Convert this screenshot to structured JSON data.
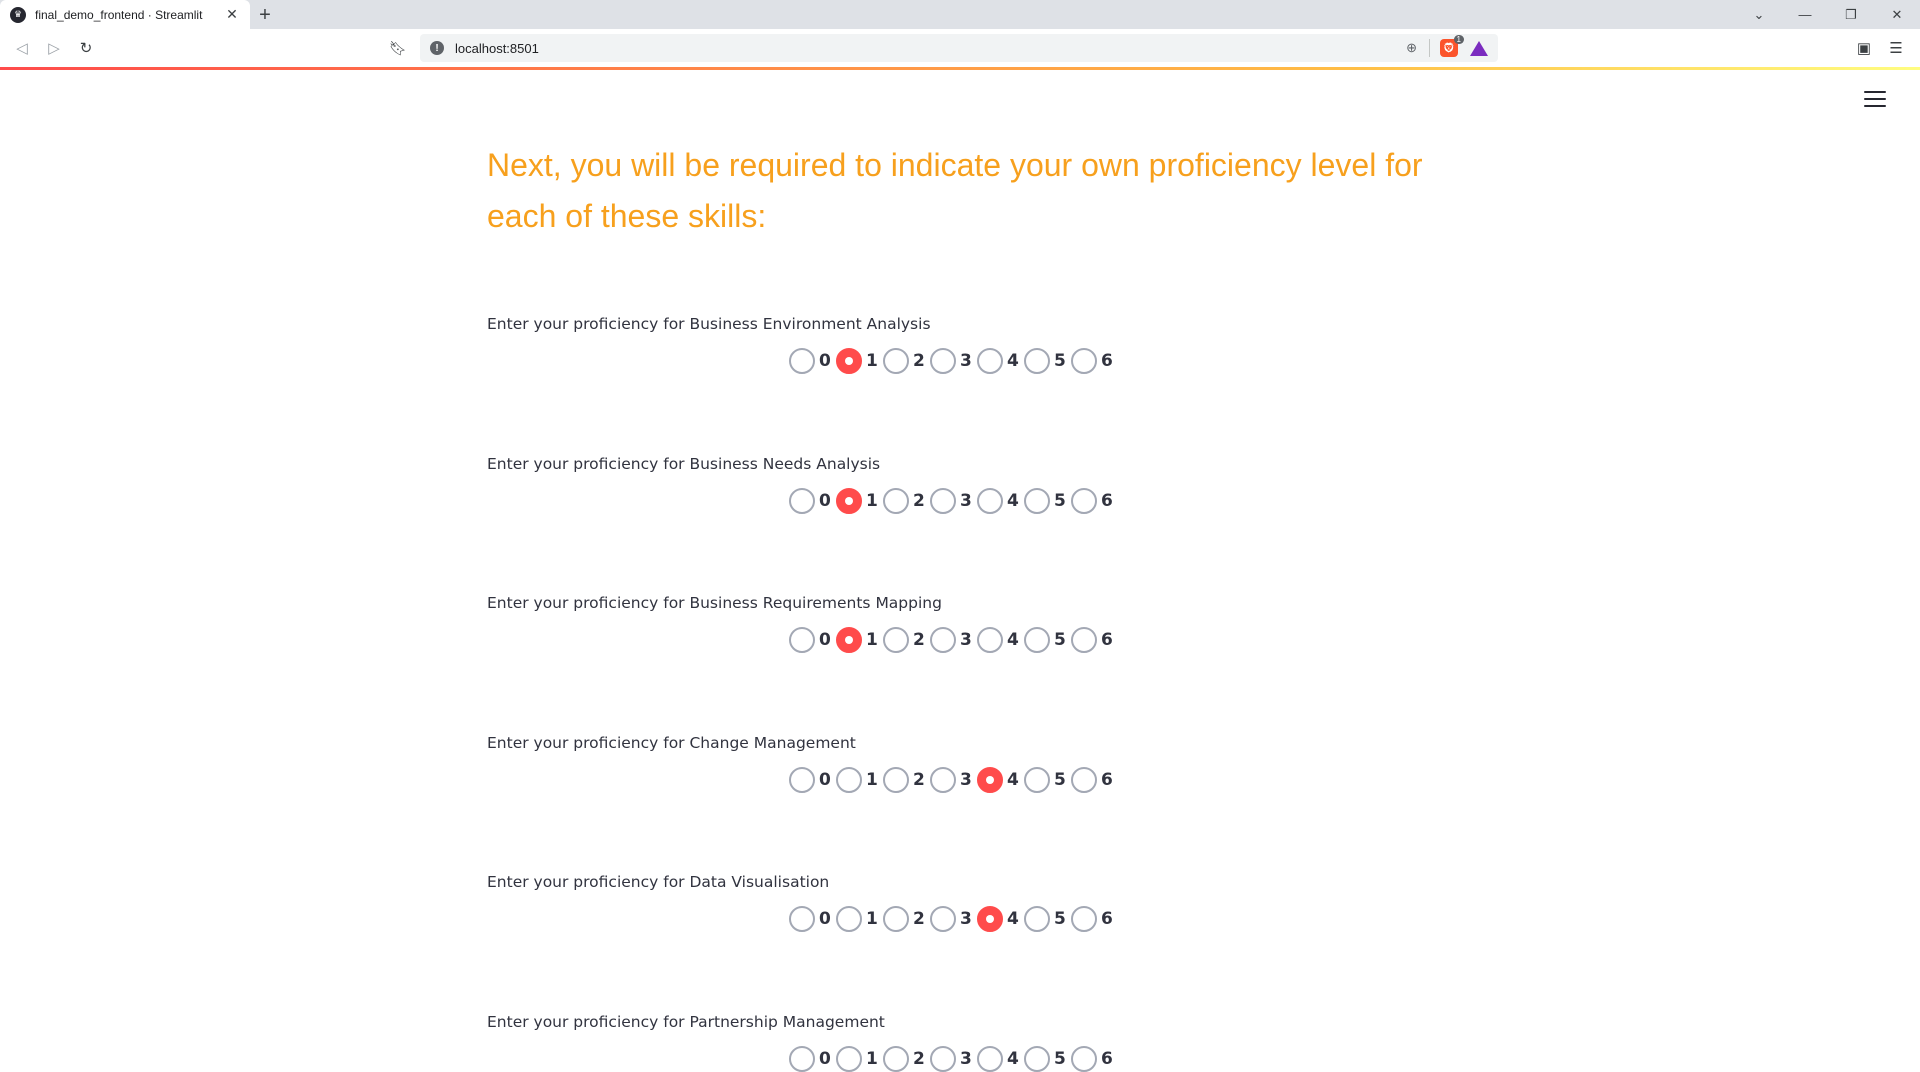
{
  "browser": {
    "tab_title": "final_demo_frontend · Streamlit",
    "url": "localhost:8501",
    "shield_badge": "1",
    "accent": "#ff4b4b"
  },
  "app": {
    "heading": "Next, you will be required to indicate your own proficiency level for each of these skills:",
    "heading_color": "#f7a01d",
    "options": [
      "0",
      "1",
      "2",
      "3",
      "4",
      "5",
      "6"
    ],
    "questions": [
      {
        "label": "Enter your proficiency for Business Environment Analysis",
        "selected": "1"
      },
      {
        "label": "Enter your proficiency for Business Needs Analysis",
        "selected": "1"
      },
      {
        "label": "Enter your proficiency for Business Requirements Mapping",
        "selected": "1"
      },
      {
        "label": "Enter your proficiency for Change Management",
        "selected": "4"
      },
      {
        "label": "Enter your proficiency for Data Visualisation",
        "selected": "4"
      },
      {
        "label": "Enter your proficiency for Partnership Management",
        "selected": null
      }
    ]
  }
}
